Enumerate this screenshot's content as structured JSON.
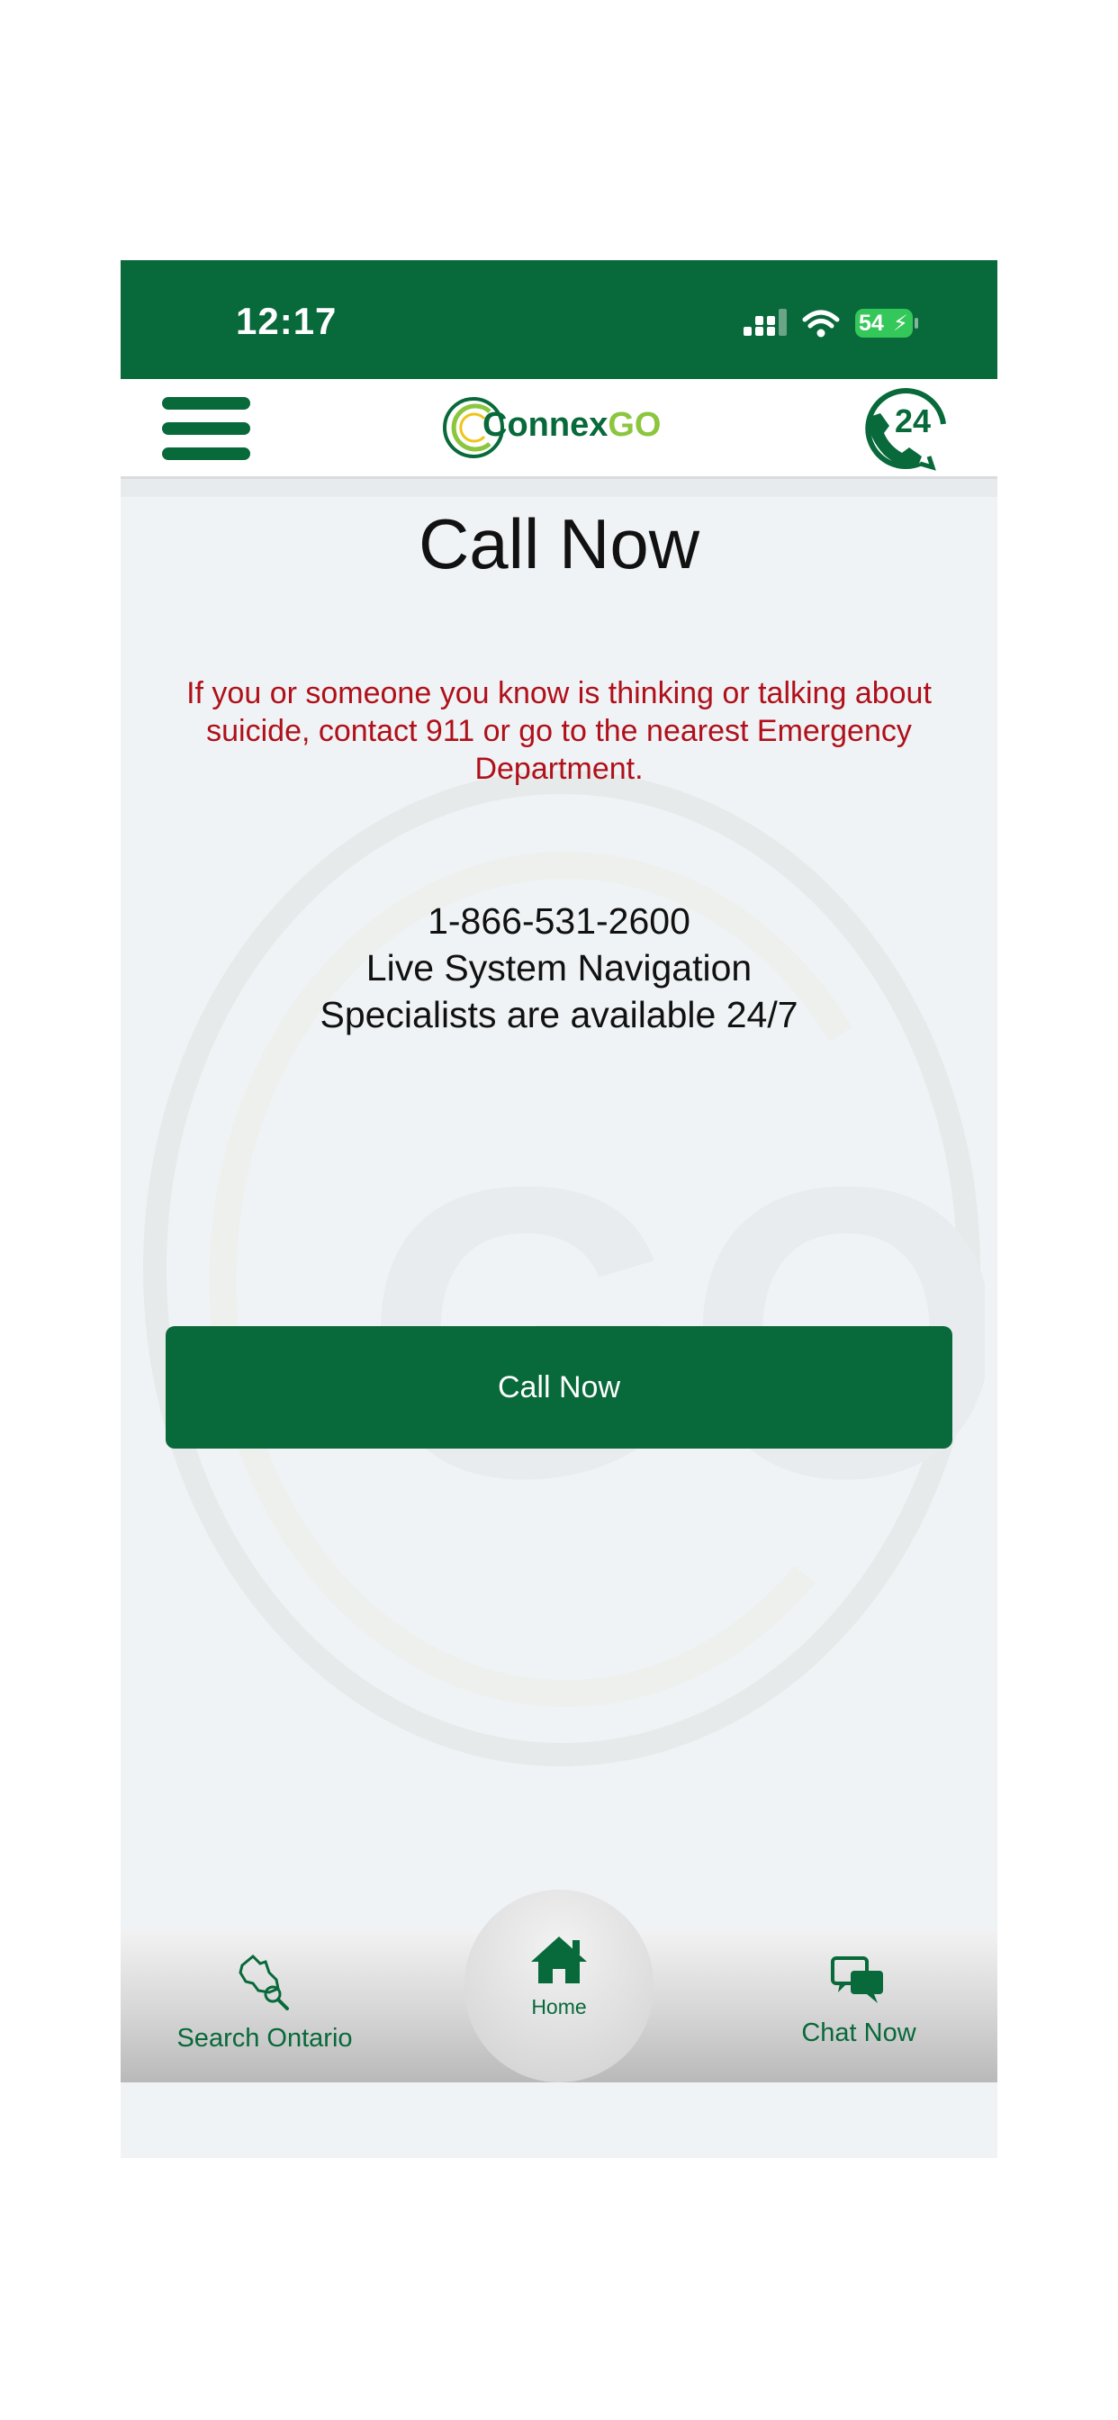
{
  "status_bar": {
    "time": "12:17",
    "battery": "54",
    "icons": [
      "signal-icon",
      "wifi-icon",
      "battery-charging-icon"
    ]
  },
  "header": {
    "logo": {
      "connex": "Connex",
      "go": "GO"
    },
    "menu_icon": "hamburger-menu-icon",
    "call_24_icon": "phone-24-hours-icon",
    "call_24_text": "24"
  },
  "main": {
    "title": "Call Now",
    "warning": "If you or someone you know is thinking or talking about suicide, contact 911 or go to the nearest Emergency Department.",
    "phone_number": "1-866-531-2600",
    "info_line1": "Live System Navigation",
    "info_line2": "Specialists are available 24/7",
    "call_button": "Call Now"
  },
  "bottom_nav": {
    "items": [
      {
        "label": "Search Ontario",
        "icon": "ontario-map-search-icon"
      },
      {
        "label": "Home",
        "icon": "home-icon"
      },
      {
        "label": "Chat Now",
        "icon": "chat-bubbles-icon"
      }
    ]
  },
  "colors": {
    "brand_green": "#08693a",
    "accent_lime": "#8cc63f",
    "warning_red": "#b0101a",
    "background": "#eff3f5"
  }
}
